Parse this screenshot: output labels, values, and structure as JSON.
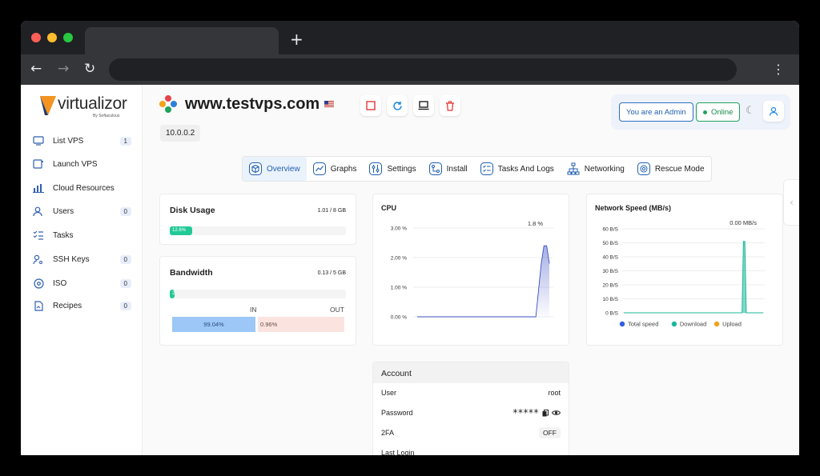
{
  "browser": {
    "new_tab_symbol": "+",
    "back_symbol": "←",
    "forward_symbol": "→",
    "reload_symbol": "↻",
    "menu_symbol": "⋮"
  },
  "logo": {
    "name": "virtualizor",
    "sub": "By Softaculous"
  },
  "sidebar": {
    "items": [
      {
        "label": "List VPS",
        "badge": "1",
        "icon": "monitor-icon"
      },
      {
        "label": "Launch VPS",
        "badge": "",
        "icon": "launch-icon"
      },
      {
        "label": "Cloud Resources",
        "badge": "",
        "icon": "bar-chart-icon"
      },
      {
        "label": "Users",
        "badge": "0",
        "icon": "users-icon"
      },
      {
        "label": "Tasks",
        "badge": "",
        "icon": "tasks-icon"
      },
      {
        "label": "SSH Keys",
        "badge": "0",
        "icon": "key-user-icon"
      },
      {
        "label": "ISO",
        "badge": "0",
        "icon": "disc-icon"
      },
      {
        "label": "Recipes",
        "badge": "0",
        "icon": "recipe-icon"
      }
    ]
  },
  "header": {
    "hostname": "www.testvps.com",
    "ip": "10.0.0.2",
    "admin_label": "You are an Admin",
    "status_label": "Online"
  },
  "tabs": [
    {
      "label": "Overview",
      "icon": "box-icon",
      "active": true
    },
    {
      "label": "Graphs",
      "icon": "line-graph-icon",
      "active": false
    },
    {
      "label": "Settings",
      "icon": "sliders-icon",
      "active": false
    },
    {
      "label": "Install",
      "icon": "install-icon",
      "active": false
    },
    {
      "label": "Tasks And Logs",
      "icon": "checklist-icon",
      "active": false
    },
    {
      "label": "Networking",
      "icon": "network-icon",
      "active": false
    },
    {
      "label": "Rescue Mode",
      "icon": "rescue-icon",
      "active": false
    }
  ],
  "disk": {
    "title": "Disk Usage",
    "value": "1.01 / 8 GB",
    "percent_label": "12.6%",
    "fraction": 0.126,
    "color": "#22c997"
  },
  "bandwidth": {
    "title": "Bandwidth",
    "value": "0.13 / 5 GB",
    "percent_label": "2",
    "fraction": 0.026,
    "in_label": "IN",
    "out_label": "OUT",
    "in_percent": "99.04%",
    "out_percent": "0.96%",
    "color": "#22c997"
  },
  "cpu": {
    "title": "CPU",
    "current": "1.8 %",
    "chart_data": {
      "type": "area",
      "ylabels": [
        "3.00 %",
        "2.00 %",
        "1.00 %",
        "0.00 %"
      ],
      "ylim": [
        0,
        3
      ],
      "values": [
        0,
        0,
        0,
        0,
        0,
        0,
        0,
        0,
        0,
        0,
        0,
        0,
        0,
        0,
        0,
        0,
        0,
        0,
        0,
        0,
        0,
        0,
        0,
        0,
        0,
        0,
        0,
        0,
        0,
        0,
        0,
        0,
        0,
        0,
        0,
        0,
        0,
        0,
        0,
        0,
        0,
        0,
        0,
        0,
        0,
        0.9,
        1.8,
        2.4,
        2.4,
        1.8
      ],
      "color": "#3a4fc4"
    }
  },
  "network": {
    "title": "Network Speed (MB/s)",
    "current": "0.00 MB/s",
    "chart_data": {
      "type": "area",
      "ylabels": [
        "60 B/S",
        "50 B/S",
        "40 B/S",
        "30 B/S",
        "20 B/S",
        "10 B/S",
        "0 B/S"
      ],
      "ylim": [
        0,
        60
      ],
      "series": [
        {
          "name": "Total speed",
          "color": "#2f5fe0",
          "values": []
        },
        {
          "name": "Download",
          "color": "#1bb89a",
          "values": [
            0,
            0,
            0,
            0,
            0,
            0,
            0,
            0,
            0,
            0,
            0,
            0,
            0,
            0,
            0,
            0,
            0,
            0,
            0,
            0,
            0,
            0,
            0,
            0,
            0,
            0,
            0,
            0,
            0,
            0,
            0,
            0,
            0,
            0,
            0,
            0,
            0,
            0,
            0,
            0,
            0,
            0,
            0,
            0,
            0,
            0,
            0,
            0,
            0,
            0,
            0,
            0,
            0,
            0,
            0,
            0,
            0,
            0,
            0,
            0,
            0,
            0,
            0,
            0,
            0,
            0,
            0,
            0,
            0,
            0,
            0,
            0,
            0,
            0,
            0,
            0,
            0,
            0,
            0,
            0,
            0,
            0,
            0,
            0,
            0,
            51,
            51,
            0,
            0,
            0,
            0,
            0,
            0,
            0,
            0,
            0,
            0,
            0,
            0,
            0
          ]
        },
        {
          "name": "Upload",
          "color": "#f0a21a",
          "values": []
        }
      ]
    }
  },
  "account": {
    "title": "Account",
    "rows": [
      {
        "label": "User",
        "value": "root"
      },
      {
        "label": "Password",
        "value": "*****"
      },
      {
        "label": "2FA",
        "value": "OFF"
      },
      {
        "label": "Last Login",
        "value": ""
      }
    ]
  }
}
